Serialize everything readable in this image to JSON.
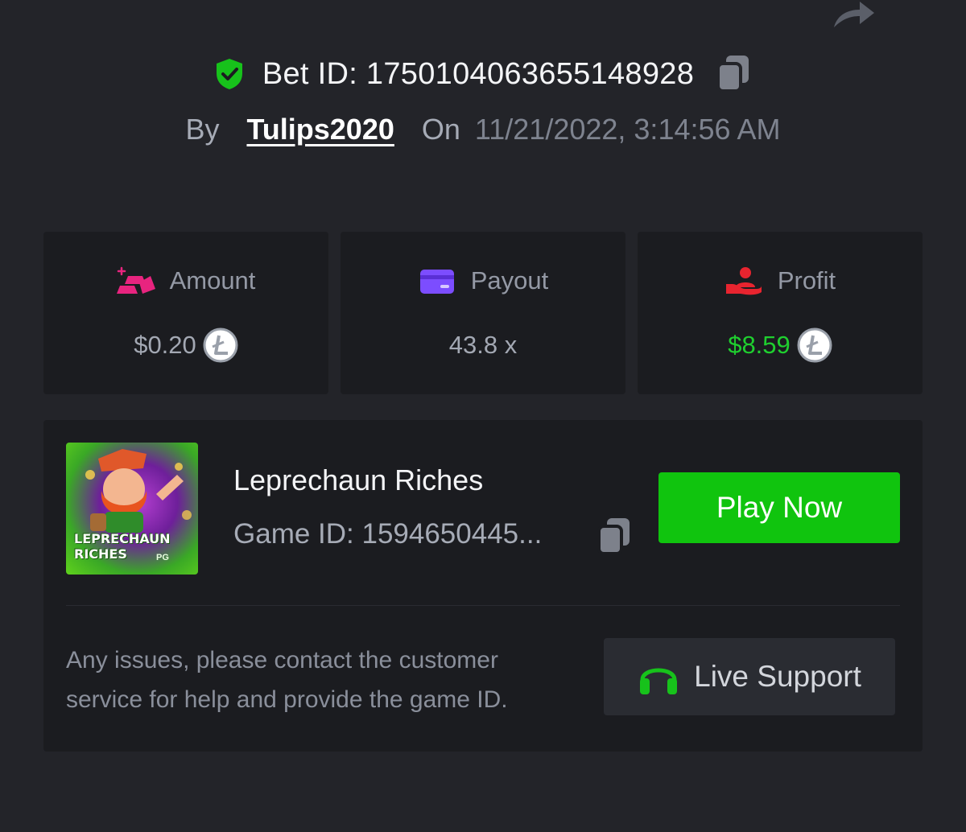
{
  "header": {
    "share_icon": "share-icon",
    "bet_id_label": "Bet ID: 1750104063655148928",
    "by_label": "By",
    "username": "Tulips2020",
    "on_label": "On",
    "datetime": "11/21/2022, 3:14:56 AM"
  },
  "stats": [
    {
      "label": "Amount",
      "value": "$0.20",
      "icon": "gold-bars-icon",
      "coin": "litecoin-icon"
    },
    {
      "label": "Payout",
      "value": "43.8 x",
      "icon": "card-icon"
    },
    {
      "label": "Profit",
      "value": "$8.59",
      "icon": "hand-person-icon",
      "coin": "litecoin-icon"
    }
  ],
  "game": {
    "thumbnail_title": "LEPRECHAUN RICHES",
    "thumbnail_brand": "PG",
    "name": "Leprechaun Riches",
    "game_id": "Game ID: 1594650445...",
    "play_label": "Play Now"
  },
  "support": {
    "help_text": "Any issues, please contact the customer service for help and provide the game ID.",
    "button_label": "Live Support"
  },
  "colors": {
    "background": "#232429",
    "card": "#1b1c20",
    "accent_green": "#10c40e",
    "profit_green": "#1fcf2f",
    "amount_pink": "#e8247f",
    "payout_purple": "#7c4dff",
    "profit_red": "#e8242f"
  }
}
